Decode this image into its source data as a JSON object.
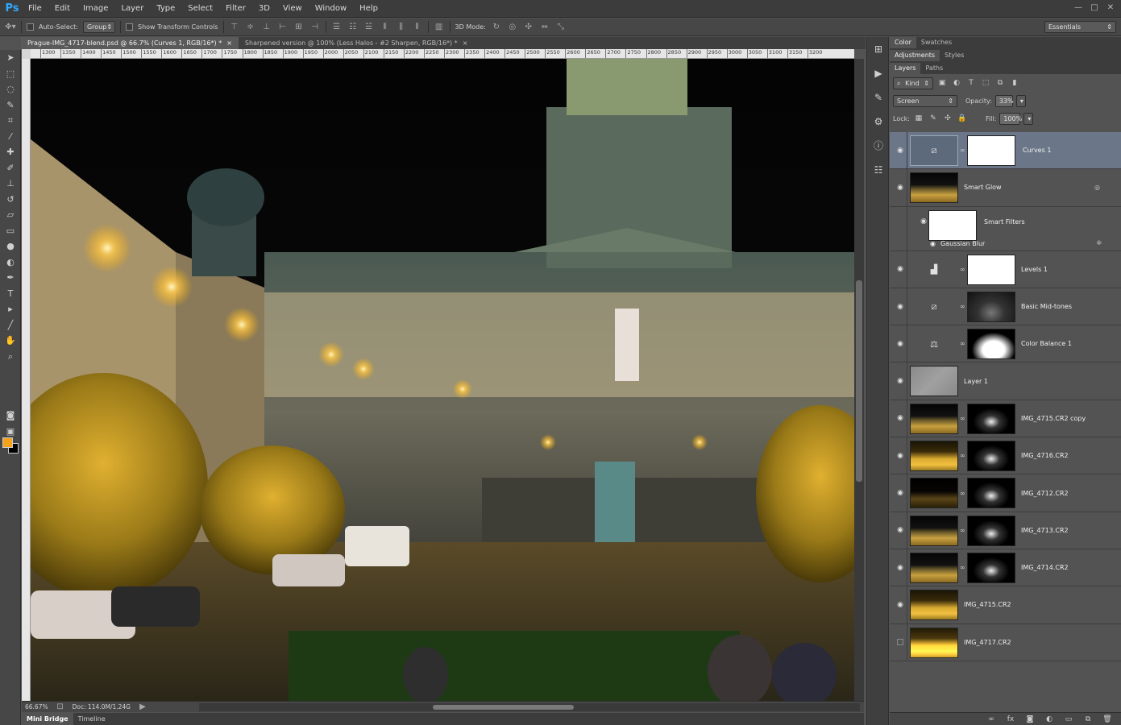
{
  "app": {
    "logo": "Ps"
  },
  "menu": [
    "File",
    "Edit",
    "Image",
    "Layer",
    "Type",
    "Select",
    "Filter",
    "3D",
    "View",
    "Window",
    "Help"
  ],
  "window_controls": [
    "—",
    "□",
    "✕"
  ],
  "options": {
    "auto_select_label": "Auto-Select:",
    "auto_select_value": "Group",
    "show_transform_label": "Show Transform Controls",
    "mode_3d_label": "3D Mode:",
    "workspace": "Essentials"
  },
  "tabs": [
    {
      "label": "Prague-IMG_4717-blend.psd @ 66.7% (Curves 1, RGB/16*) *",
      "close": "×"
    },
    {
      "label": "Sharpened version @ 100% (Less Halos - #2 Sharpen, RGB/16*) *",
      "close": "×"
    }
  ],
  "ruler_ticks": [
    "1300",
    "1350",
    "1400",
    "1450",
    "1500",
    "1550",
    "1600",
    "1650",
    "1700",
    "1750",
    "1800",
    "1850",
    "1900",
    "1950",
    "2000",
    "2050",
    "2100",
    "2150",
    "2200",
    "2250",
    "2300",
    "2350",
    "2400",
    "2450",
    "2500",
    "2550",
    "2600",
    "2650",
    "2700",
    "2750",
    "2800",
    "2850",
    "2900",
    "2950",
    "3000",
    "3050",
    "3100",
    "3150",
    "3200"
  ],
  "status": {
    "zoom": "66.67%",
    "doc": "Doc: 114.0M/1.24G"
  },
  "bottom_tabs": [
    "Mini Bridge",
    "Timeline"
  ],
  "panels": {
    "group1": [
      "Color",
      "Swatches"
    ],
    "group2": [
      "Adjustments",
      "Styles"
    ],
    "group3": [
      "Layers",
      "Paths"
    ]
  },
  "layers_panel": {
    "kind_label": "Kind",
    "blend_mode": "Screen",
    "opacity_label": "Opacity:",
    "opacity_value": "33%",
    "lock_label": "Lock:",
    "fill_label": "Fill:",
    "fill_value": "100%"
  },
  "layers": [
    {
      "name": "Curves 1",
      "selected": true
    },
    {
      "name": "Smart Glow"
    },
    {
      "name": "Smart Filters"
    },
    {
      "name": "Gaussian Blur"
    },
    {
      "name": "Levels 1"
    },
    {
      "name": "Basic Mid-tones"
    },
    {
      "name": "Color Balance 1"
    },
    {
      "name": "Layer 1"
    },
    {
      "name": "IMG_4715.CR2 copy"
    },
    {
      "name": "IMG_4716.CR2"
    },
    {
      "name": "IMG_4712.CR2"
    },
    {
      "name": "IMG_4713.CR2"
    },
    {
      "name": "IMG_4714.CR2"
    },
    {
      "name": "IMG_4715.CR2"
    },
    {
      "name": "IMG_4717.CR2",
      "hidden": true
    }
  ],
  "colors": {
    "foreground": "#f7a21b",
    "background": "#000000",
    "selection": "#6b7789"
  }
}
